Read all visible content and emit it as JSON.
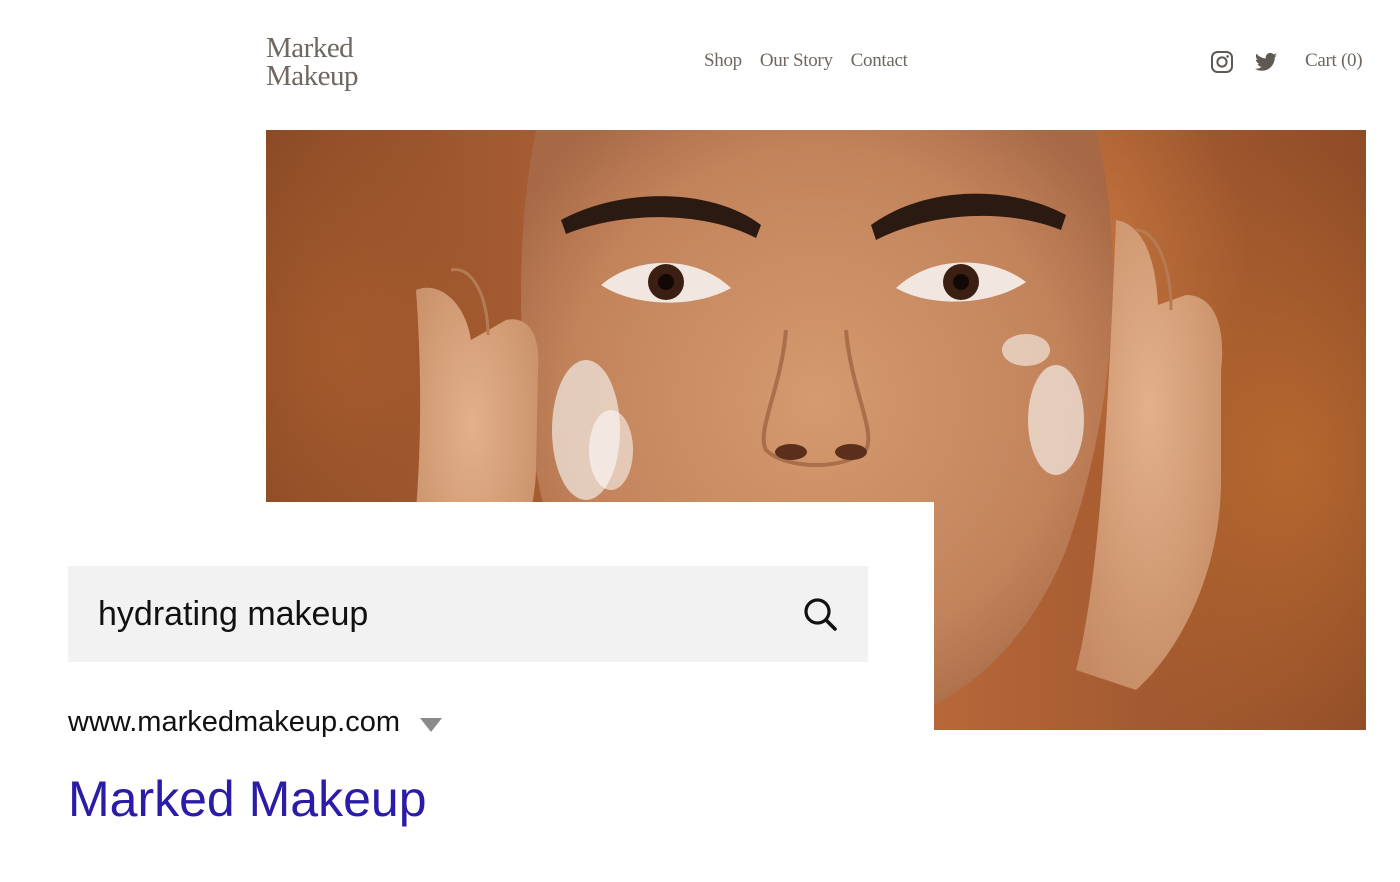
{
  "brand": {
    "line1": "Marked",
    "line2": "Makeup",
    "text_color": "#6f6760"
  },
  "nav": {
    "items": [
      {
        "label": "Shop"
      },
      {
        "label": "Our Story"
      },
      {
        "label": "Contact"
      }
    ]
  },
  "social": {
    "icons": [
      "instagram-icon",
      "twitter-icon"
    ]
  },
  "cart": {
    "label": "Cart (0)"
  },
  "search": {
    "query": "hydrating makeup",
    "icon": "search-icon"
  },
  "result": {
    "url": "www.markedmakeup.com",
    "title": "Marked Makeup",
    "title_color": "#2a1ca8"
  }
}
